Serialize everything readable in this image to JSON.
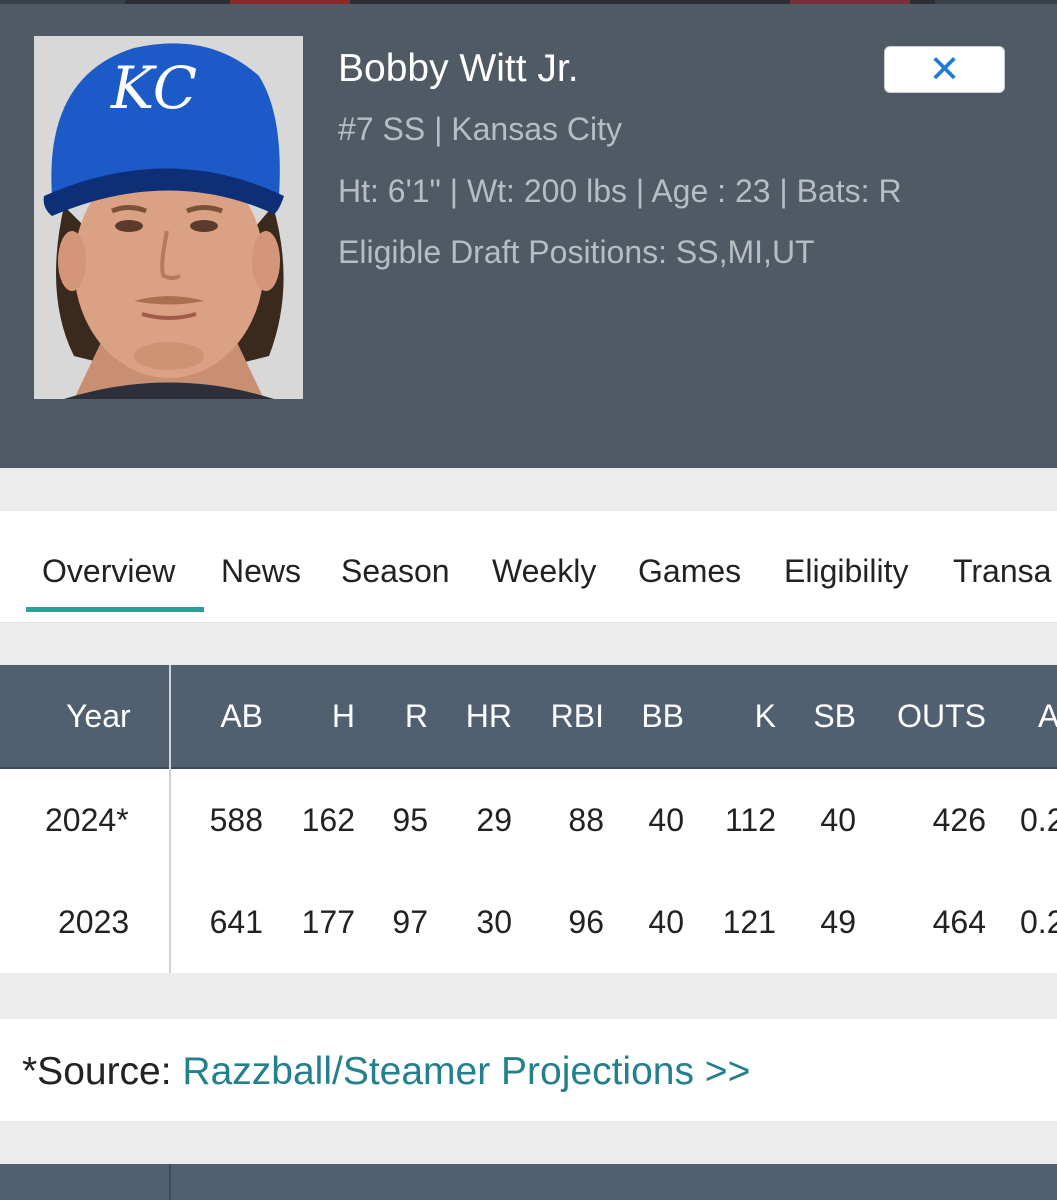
{
  "player": {
    "name": "Bobby Witt Jr.",
    "number_position_team": "#7 SS | Kansas City",
    "bio": "Ht: 6'1\" | Wt: 200 lbs | Age : 23 | Bats: R",
    "eligible": "Eligible Draft Positions: SS,MI,UT",
    "photo_icon": "player-headshot",
    "cap_logo": "KC"
  },
  "close_button": {
    "label": "✕",
    "icon": "close-icon",
    "color": "#1f7ad8"
  },
  "tabs": [
    {
      "label": "Overview",
      "active": true
    },
    {
      "label": "News"
    },
    {
      "label": "Season"
    },
    {
      "label": "Weekly"
    },
    {
      "label": "Games"
    },
    {
      "label": "Eligibility"
    },
    {
      "label": "Transa"
    }
  ],
  "stats": {
    "headers": [
      "Year",
      "AB",
      "H",
      "R",
      "HR",
      "RBI",
      "BB",
      "K",
      "SB",
      "OUTS",
      "A"
    ],
    "rows": [
      [
        "2024*",
        "588",
        "162",
        "95",
        "29",
        "88",
        "40",
        "112",
        "40",
        "426",
        "0.2"
      ],
      [
        "2023",
        "641",
        "177",
        "97",
        "30",
        "96",
        "40",
        "121",
        "49",
        "464",
        "0.2"
      ]
    ]
  },
  "source": {
    "prefix": "*Source: ",
    "link": "Razzball/Steamer Projections >>"
  },
  "colors": {
    "header_bg": "#505a64",
    "table_header_bg": "#506070",
    "accent": "#2aa198",
    "link": "#23808c"
  }
}
